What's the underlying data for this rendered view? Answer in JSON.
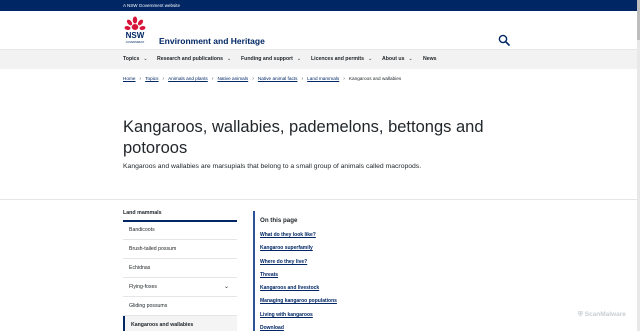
{
  "topbar": {
    "text": "A NSW Government website"
  },
  "header": {
    "logo_text": "NSW",
    "logo_subtext": "GOVERNMENT",
    "site_title": "Environment and Heritage"
  },
  "nav": {
    "items": [
      {
        "label": "Topics",
        "has_menu": true
      },
      {
        "label": "Research and publications",
        "has_menu": true
      },
      {
        "label": "Funding and support",
        "has_menu": true
      },
      {
        "label": "Licences and permits",
        "has_menu": true
      },
      {
        "label": "About us",
        "has_menu": true
      },
      {
        "label": "News",
        "has_menu": false
      }
    ]
  },
  "breadcrumb": {
    "links": [
      "Home",
      "Topics",
      "Animals and plants",
      "Native animals",
      "Native animal facts",
      "Land mammals"
    ],
    "current": "Kangaroos and wallabies"
  },
  "hero": {
    "title": "Kangaroos, wallabies, pademelons, bettongs and potoroos",
    "intro": "Kangaroos and wallabies are marsupials that belong to a small group of animals called macropods."
  },
  "sidenav": {
    "title": "Land mammals",
    "items": [
      {
        "label": "Bandicoots",
        "expandable": false,
        "active": false
      },
      {
        "label": "Brush-tailed possum",
        "expandable": false,
        "active": false
      },
      {
        "label": "Echidnas",
        "expandable": false,
        "active": false
      },
      {
        "label": "Flying-foxes",
        "expandable": true,
        "active": false
      },
      {
        "label": "Gliding possums",
        "expandable": false,
        "active": false
      },
      {
        "label": "Kangaroos and wallabies",
        "expandable": false,
        "active": true
      }
    ]
  },
  "on_this_page": {
    "heading": "On this page",
    "links": [
      "What do they look like?",
      "Kangaroo superfamily",
      "Where do they live?",
      "Threats",
      "Kangaroos and livestock",
      "Managing kangaroo populations",
      "Living with kangaroos",
      "Download"
    ]
  },
  "watermark": {
    "text": "ScanMalware"
  },
  "colors": {
    "brand_navy": "#002664",
    "brand_red": "#d7153a",
    "nav_bg": "#f2f2f2"
  }
}
